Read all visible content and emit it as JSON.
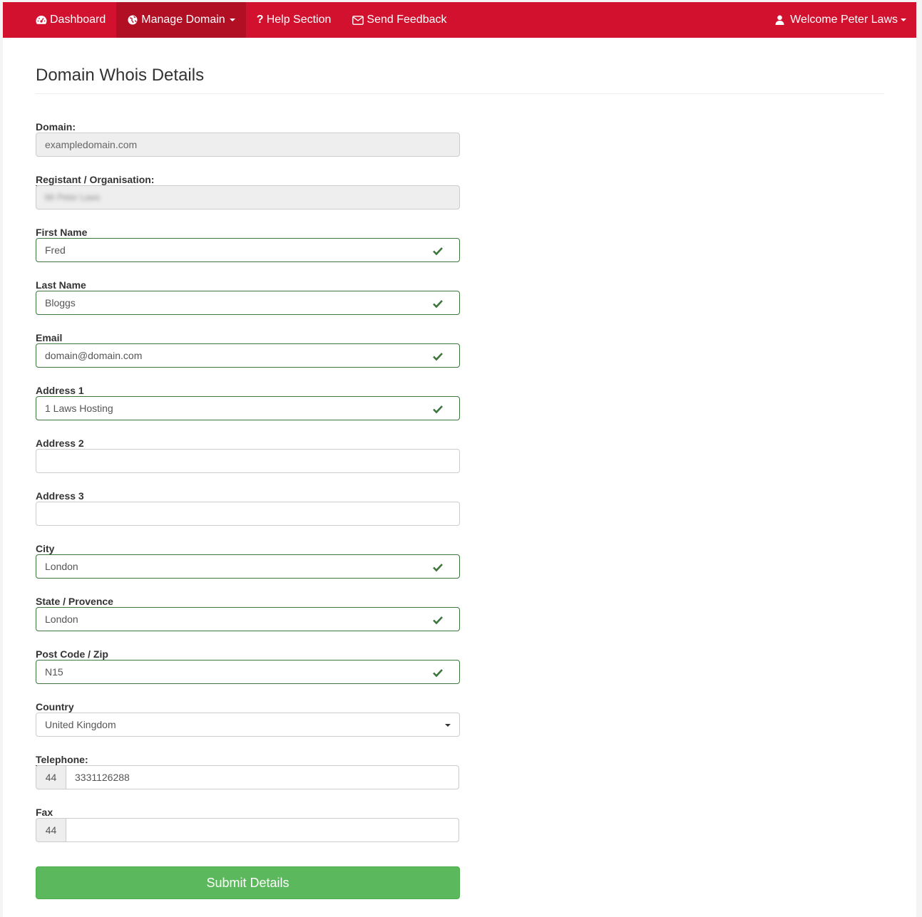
{
  "navbar": {
    "items": [
      {
        "label": "Dashboard",
        "icon": "dashboard-icon"
      },
      {
        "label": "Manage Domain",
        "icon": "globe-icon"
      },
      {
        "label": "Help Section",
        "icon": "question-icon"
      },
      {
        "label": "Send Feedback",
        "icon": "envelope-icon"
      }
    ],
    "user_label": "Welcome Peter Laws",
    "color": "#d2112e",
    "active_color": "#b10f24"
  },
  "page": {
    "title": "Domain Whois Details"
  },
  "form": {
    "domain": {
      "label": "Domain:",
      "value": "exampledomain.com"
    },
    "registrant": {
      "label": "Registant / Organisation:",
      "value": "Mr Peter Laws"
    },
    "first_name": {
      "label": "First Name",
      "value": "Fred"
    },
    "last_name": {
      "label": "Last Name",
      "value": "Bloggs"
    },
    "email": {
      "label": "Email",
      "value": "domain@domain.com"
    },
    "address1": {
      "label": "Address 1",
      "value": "1 Laws Hosting"
    },
    "address2": {
      "label": "Address 2",
      "value": ""
    },
    "address3": {
      "label": "Address 3",
      "value": ""
    },
    "city": {
      "label": "City",
      "value": "London"
    },
    "state": {
      "label": "State / Provence",
      "value": "London"
    },
    "postcode": {
      "label": "Post Code / Zip",
      "value": "N15"
    },
    "country": {
      "label": "Country",
      "value": "United Kingdom"
    },
    "telephone": {
      "label": "Telephone:",
      "prefix": "44",
      "value": "3331126288"
    },
    "fax": {
      "label": "Fax",
      "prefix": "44",
      "value": ""
    },
    "submit_label": "Submit Details",
    "valid_color": "#3c763d",
    "submit_color": "#5cb85c"
  }
}
